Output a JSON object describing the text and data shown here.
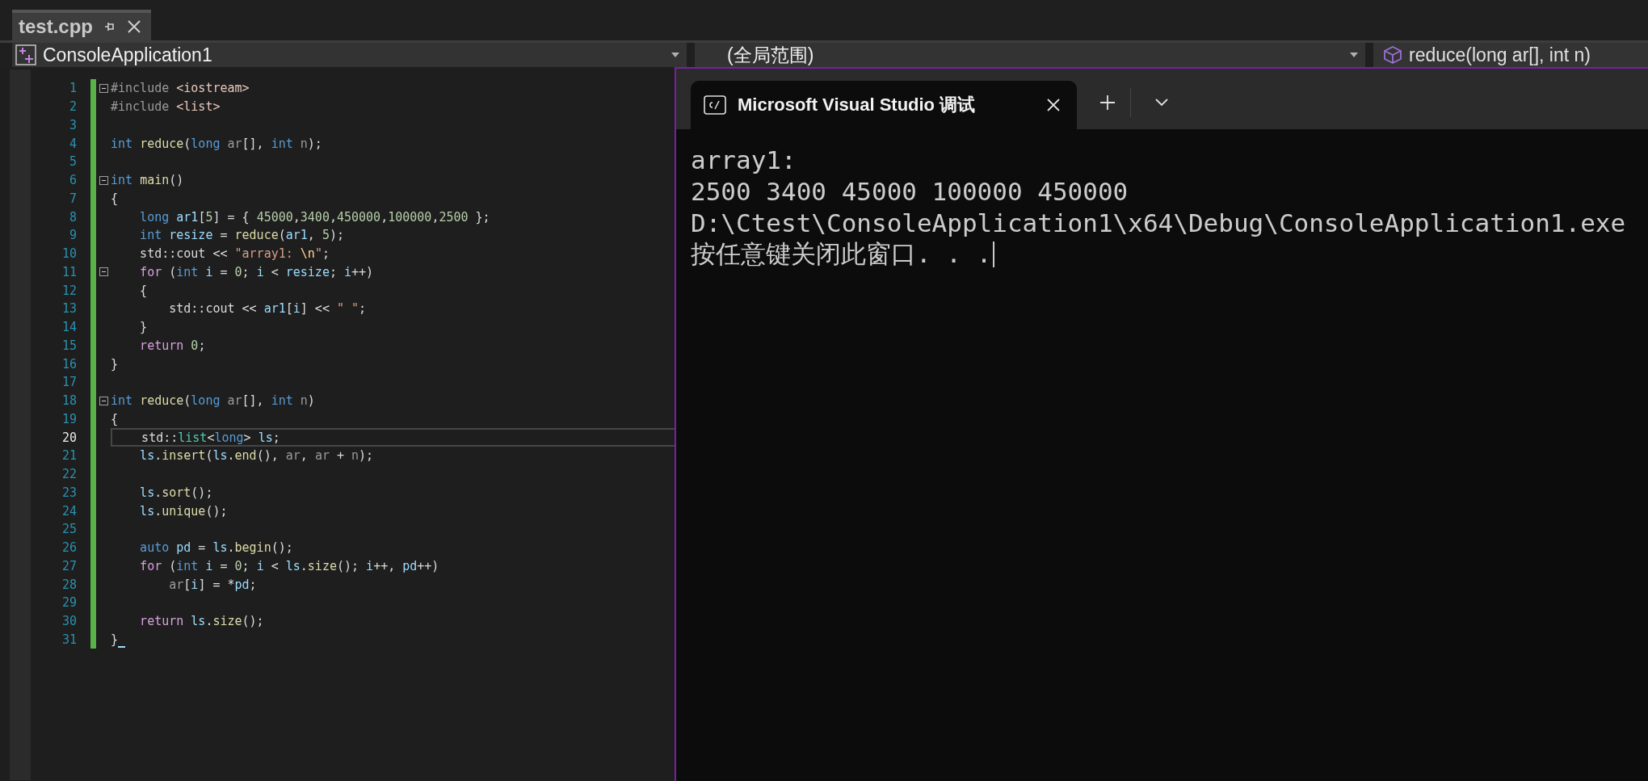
{
  "editor_tabs": [
    {
      "label": "test.cpp",
      "selected": true
    }
  ],
  "navigation_bar": {
    "project": "ConsoleApplication1",
    "scope": "(全局范围)",
    "member": "reduce(long ar[], int n)"
  },
  "code": {
    "lines": [
      {
        "number": "1",
        "fold": true,
        "current": false,
        "tokens": [
          {
            "kind": "directive",
            "text": "#include "
          },
          {
            "kind": "path",
            "text": "<iostream>"
          }
        ]
      },
      {
        "number": "2",
        "fold": false,
        "current": false,
        "tokens": [
          {
            "kind": "directive",
            "text": "#include "
          },
          {
            "kind": "path",
            "text": "<list>"
          }
        ]
      },
      {
        "number": "3",
        "fold": false,
        "current": false
      },
      {
        "number": "4",
        "fold": false,
        "current": false,
        "tokens": [
          {
            "kind": "keyword",
            "text": "int "
          },
          {
            "kind": "function",
            "text": "reduce"
          },
          {
            "kind": "plain",
            "text": "("
          },
          {
            "kind": "keyword",
            "text": "long "
          },
          {
            "kind": "param",
            "text": "ar"
          },
          {
            "kind": "plain",
            "text": "[], "
          },
          {
            "kind": "keyword",
            "text": "int "
          },
          {
            "kind": "param",
            "text": "n"
          },
          {
            "kind": "plain",
            "text": ");"
          }
        ]
      },
      {
        "number": "5",
        "fold": false,
        "current": false
      },
      {
        "number": "6",
        "fold": true,
        "current": false,
        "tokens": [
          {
            "kind": "keyword",
            "text": "int "
          },
          {
            "kind": "function",
            "text": "main"
          },
          {
            "kind": "plain",
            "text": "()"
          }
        ]
      },
      {
        "number": "7",
        "fold": false,
        "current": false,
        "tokens": [
          {
            "kind": "plain",
            "text": "{"
          }
        ]
      },
      {
        "number": "8",
        "fold": false,
        "current": false,
        "tokens": [
          {
            "kind": "keyword",
            "text": "    long "
          },
          {
            "kind": "local",
            "text": "ar1"
          },
          {
            "kind": "plain",
            "text": "["
          },
          {
            "kind": "number",
            "text": "5"
          },
          {
            "kind": "plain",
            "text": "] = { "
          },
          {
            "kind": "number",
            "text": "45000"
          },
          {
            "kind": "plain",
            "text": ","
          },
          {
            "kind": "number",
            "text": "3400"
          },
          {
            "kind": "plain",
            "text": ","
          },
          {
            "kind": "number",
            "text": "450000"
          },
          {
            "kind": "plain",
            "text": ","
          },
          {
            "kind": "number",
            "text": "100000"
          },
          {
            "kind": "plain",
            "text": ","
          },
          {
            "kind": "number",
            "text": "2500"
          },
          {
            "kind": "plain",
            "text": " };"
          }
        ]
      },
      {
        "number": "9",
        "fold": false,
        "current": false,
        "tokens": [
          {
            "kind": "keyword",
            "text": "    int "
          },
          {
            "kind": "local",
            "text": "resize"
          },
          {
            "kind": "plain",
            "text": " = "
          },
          {
            "kind": "function",
            "text": "reduce"
          },
          {
            "kind": "plain",
            "text": "("
          },
          {
            "kind": "local",
            "text": "ar1"
          },
          {
            "kind": "plain",
            "text": ", "
          },
          {
            "kind": "number",
            "text": "5"
          },
          {
            "kind": "plain",
            "text": ");"
          }
        ]
      },
      {
        "number": "10",
        "fold": false,
        "current": false,
        "tokens": [
          {
            "kind": "plain",
            "text": "    std::cout << "
          },
          {
            "kind": "string",
            "text": "\"array1: "
          },
          {
            "kind": "escape",
            "text": "\\n"
          },
          {
            "kind": "string",
            "text": "\""
          },
          {
            "kind": "plain",
            "text": ";"
          }
        ]
      },
      {
        "number": "11",
        "fold": true,
        "current": false,
        "tokens": [
          {
            "kind": "control",
            "text": "    for"
          },
          {
            "kind": "plain",
            "text": " ("
          },
          {
            "kind": "keyword",
            "text": "int "
          },
          {
            "kind": "local",
            "text": "i"
          },
          {
            "kind": "plain",
            "text": " = "
          },
          {
            "kind": "number",
            "text": "0"
          },
          {
            "kind": "plain",
            "text": "; "
          },
          {
            "kind": "local",
            "text": "i"
          },
          {
            "kind": "plain",
            "text": " < "
          },
          {
            "kind": "local",
            "text": "resize"
          },
          {
            "kind": "plain",
            "text": "; "
          },
          {
            "kind": "local",
            "text": "i"
          },
          {
            "kind": "plain",
            "text": "++)"
          }
        ]
      },
      {
        "number": "12",
        "fold": false,
        "current": false,
        "tokens": [
          {
            "kind": "plain",
            "text": "    {"
          }
        ]
      },
      {
        "number": "13",
        "fold": false,
        "current": false,
        "tokens": [
          {
            "kind": "plain",
            "text": "        std::cout << "
          },
          {
            "kind": "local",
            "text": "ar1"
          },
          {
            "kind": "plain",
            "text": "["
          },
          {
            "kind": "local",
            "text": "i"
          },
          {
            "kind": "plain",
            "text": "] << "
          },
          {
            "kind": "string",
            "text": "\" \""
          },
          {
            "kind": "plain",
            "text": ";"
          }
        ]
      },
      {
        "number": "14",
        "fold": false,
        "current": false,
        "tokens": [
          {
            "kind": "plain",
            "text": "    }"
          }
        ]
      },
      {
        "number": "15",
        "fold": false,
        "current": false,
        "tokens": [
          {
            "kind": "control",
            "text": "    return "
          },
          {
            "kind": "number",
            "text": "0"
          },
          {
            "kind": "plain",
            "text": ";"
          }
        ]
      },
      {
        "number": "16",
        "fold": false,
        "current": false,
        "tokens": [
          {
            "kind": "plain",
            "text": "}"
          }
        ]
      },
      {
        "number": "17",
        "fold": false,
        "current": false
      },
      {
        "number": "18",
        "fold": true,
        "current": false,
        "tokens": [
          {
            "kind": "keyword",
            "text": "int "
          },
          {
            "kind": "function",
            "text": "reduce"
          },
          {
            "kind": "plain",
            "text": "("
          },
          {
            "kind": "keyword",
            "text": "long "
          },
          {
            "kind": "param",
            "text": "ar"
          },
          {
            "kind": "plain",
            "text": "[], "
          },
          {
            "kind": "keyword",
            "text": "int "
          },
          {
            "kind": "param",
            "text": "n"
          },
          {
            "kind": "plain",
            "text": ")"
          }
        ]
      },
      {
        "number": "19",
        "fold": false,
        "current": false,
        "tokens": [
          {
            "kind": "plain",
            "text": "{"
          }
        ]
      },
      {
        "number": "20",
        "fold": false,
        "current": true,
        "tokens": [
          {
            "kind": "plain",
            "text": "    std::"
          },
          {
            "kind": "type",
            "text": "list"
          },
          {
            "kind": "plain",
            "text": "<"
          },
          {
            "kind": "keyword",
            "text": "long"
          },
          {
            "kind": "plain",
            "text": "> "
          },
          {
            "kind": "local",
            "text": "ls"
          },
          {
            "kind": "plain",
            "text": ";"
          }
        ]
      },
      {
        "number": "21",
        "fold": false,
        "current": false,
        "tokens": [
          {
            "kind": "local",
            "text": "    ls"
          },
          {
            "kind": "plain",
            "text": "."
          },
          {
            "kind": "function",
            "text": "insert"
          },
          {
            "kind": "plain",
            "text": "("
          },
          {
            "kind": "local",
            "text": "ls"
          },
          {
            "kind": "plain",
            "text": "."
          },
          {
            "kind": "function",
            "text": "end"
          },
          {
            "kind": "plain",
            "text": "(), "
          },
          {
            "kind": "param",
            "text": "ar"
          },
          {
            "kind": "plain",
            "text": ", "
          },
          {
            "kind": "param",
            "text": "ar"
          },
          {
            "kind": "plain",
            "text": " + "
          },
          {
            "kind": "param",
            "text": "n"
          },
          {
            "kind": "plain",
            "text": ");"
          }
        ]
      },
      {
        "number": "22",
        "fold": false,
        "current": false
      },
      {
        "number": "23",
        "fold": false,
        "current": false,
        "tokens": [
          {
            "kind": "local",
            "text": "    ls"
          },
          {
            "kind": "plain",
            "text": "."
          },
          {
            "kind": "function",
            "text": "sort"
          },
          {
            "kind": "plain",
            "text": "();"
          }
        ]
      },
      {
        "number": "24",
        "fold": false,
        "current": false,
        "tokens": [
          {
            "kind": "local",
            "text": "    ls"
          },
          {
            "kind": "plain",
            "text": "."
          },
          {
            "kind": "function",
            "text": "unique"
          },
          {
            "kind": "plain",
            "text": "();"
          }
        ]
      },
      {
        "number": "25",
        "fold": false,
        "current": false
      },
      {
        "number": "26",
        "fold": false,
        "current": false,
        "tokens": [
          {
            "kind": "keyword",
            "text": "    auto "
          },
          {
            "kind": "local",
            "text": "pd"
          },
          {
            "kind": "plain",
            "text": " = "
          },
          {
            "kind": "local",
            "text": "ls"
          },
          {
            "kind": "plain",
            "text": "."
          },
          {
            "kind": "function",
            "text": "begin"
          },
          {
            "kind": "plain",
            "text": "();"
          }
        ]
      },
      {
        "number": "27",
        "fold": false,
        "current": false,
        "tokens": [
          {
            "kind": "control",
            "text": "    for"
          },
          {
            "kind": "plain",
            "text": " ("
          },
          {
            "kind": "keyword",
            "text": "int "
          },
          {
            "kind": "local",
            "text": "i"
          },
          {
            "kind": "plain",
            "text": " = "
          },
          {
            "kind": "number",
            "text": "0"
          },
          {
            "kind": "plain",
            "text": "; "
          },
          {
            "kind": "local",
            "text": "i"
          },
          {
            "kind": "plain",
            "text": " < "
          },
          {
            "kind": "local",
            "text": "ls"
          },
          {
            "kind": "plain",
            "text": "."
          },
          {
            "kind": "function",
            "text": "size"
          },
          {
            "kind": "plain",
            "text": "(); "
          },
          {
            "kind": "local",
            "text": "i"
          },
          {
            "kind": "plain",
            "text": "++, "
          },
          {
            "kind": "local",
            "text": "pd"
          },
          {
            "kind": "plain",
            "text": "++)"
          }
        ]
      },
      {
        "number": "28",
        "fold": false,
        "current": false,
        "tokens": [
          {
            "kind": "param",
            "text": "        ar"
          },
          {
            "kind": "plain",
            "text": "["
          },
          {
            "kind": "local",
            "text": "i"
          },
          {
            "kind": "plain",
            "text": "] = *"
          },
          {
            "kind": "local",
            "text": "pd"
          },
          {
            "kind": "plain",
            "text": ";"
          }
        ]
      },
      {
        "number": "29",
        "fold": false,
        "current": false
      },
      {
        "number": "30",
        "fold": false,
        "current": false,
        "tokens": [
          {
            "kind": "control",
            "text": "    return "
          },
          {
            "kind": "local",
            "text": "ls"
          },
          {
            "kind": "plain",
            "text": "."
          },
          {
            "kind": "function",
            "text": "size"
          },
          {
            "kind": "plain",
            "text": "();"
          }
        ]
      },
      {
        "number": "31",
        "fold": false,
        "current": false,
        "tokens": [
          {
            "kind": "plain",
            "text": "}"
          }
        ]
      }
    ]
  },
  "terminal": {
    "tabs": [
      {
        "title": "Microsoft Visual Studio 调试",
        "selected": true
      }
    ],
    "output": [
      "array1:",
      "2500 3400 45000 100000 450000",
      "D:\\Ctest\\ConsoleApplication1\\x64\\Debug\\ConsoleApplication1.exe",
      "按任意键关闭此窗口. . ."
    ]
  }
}
